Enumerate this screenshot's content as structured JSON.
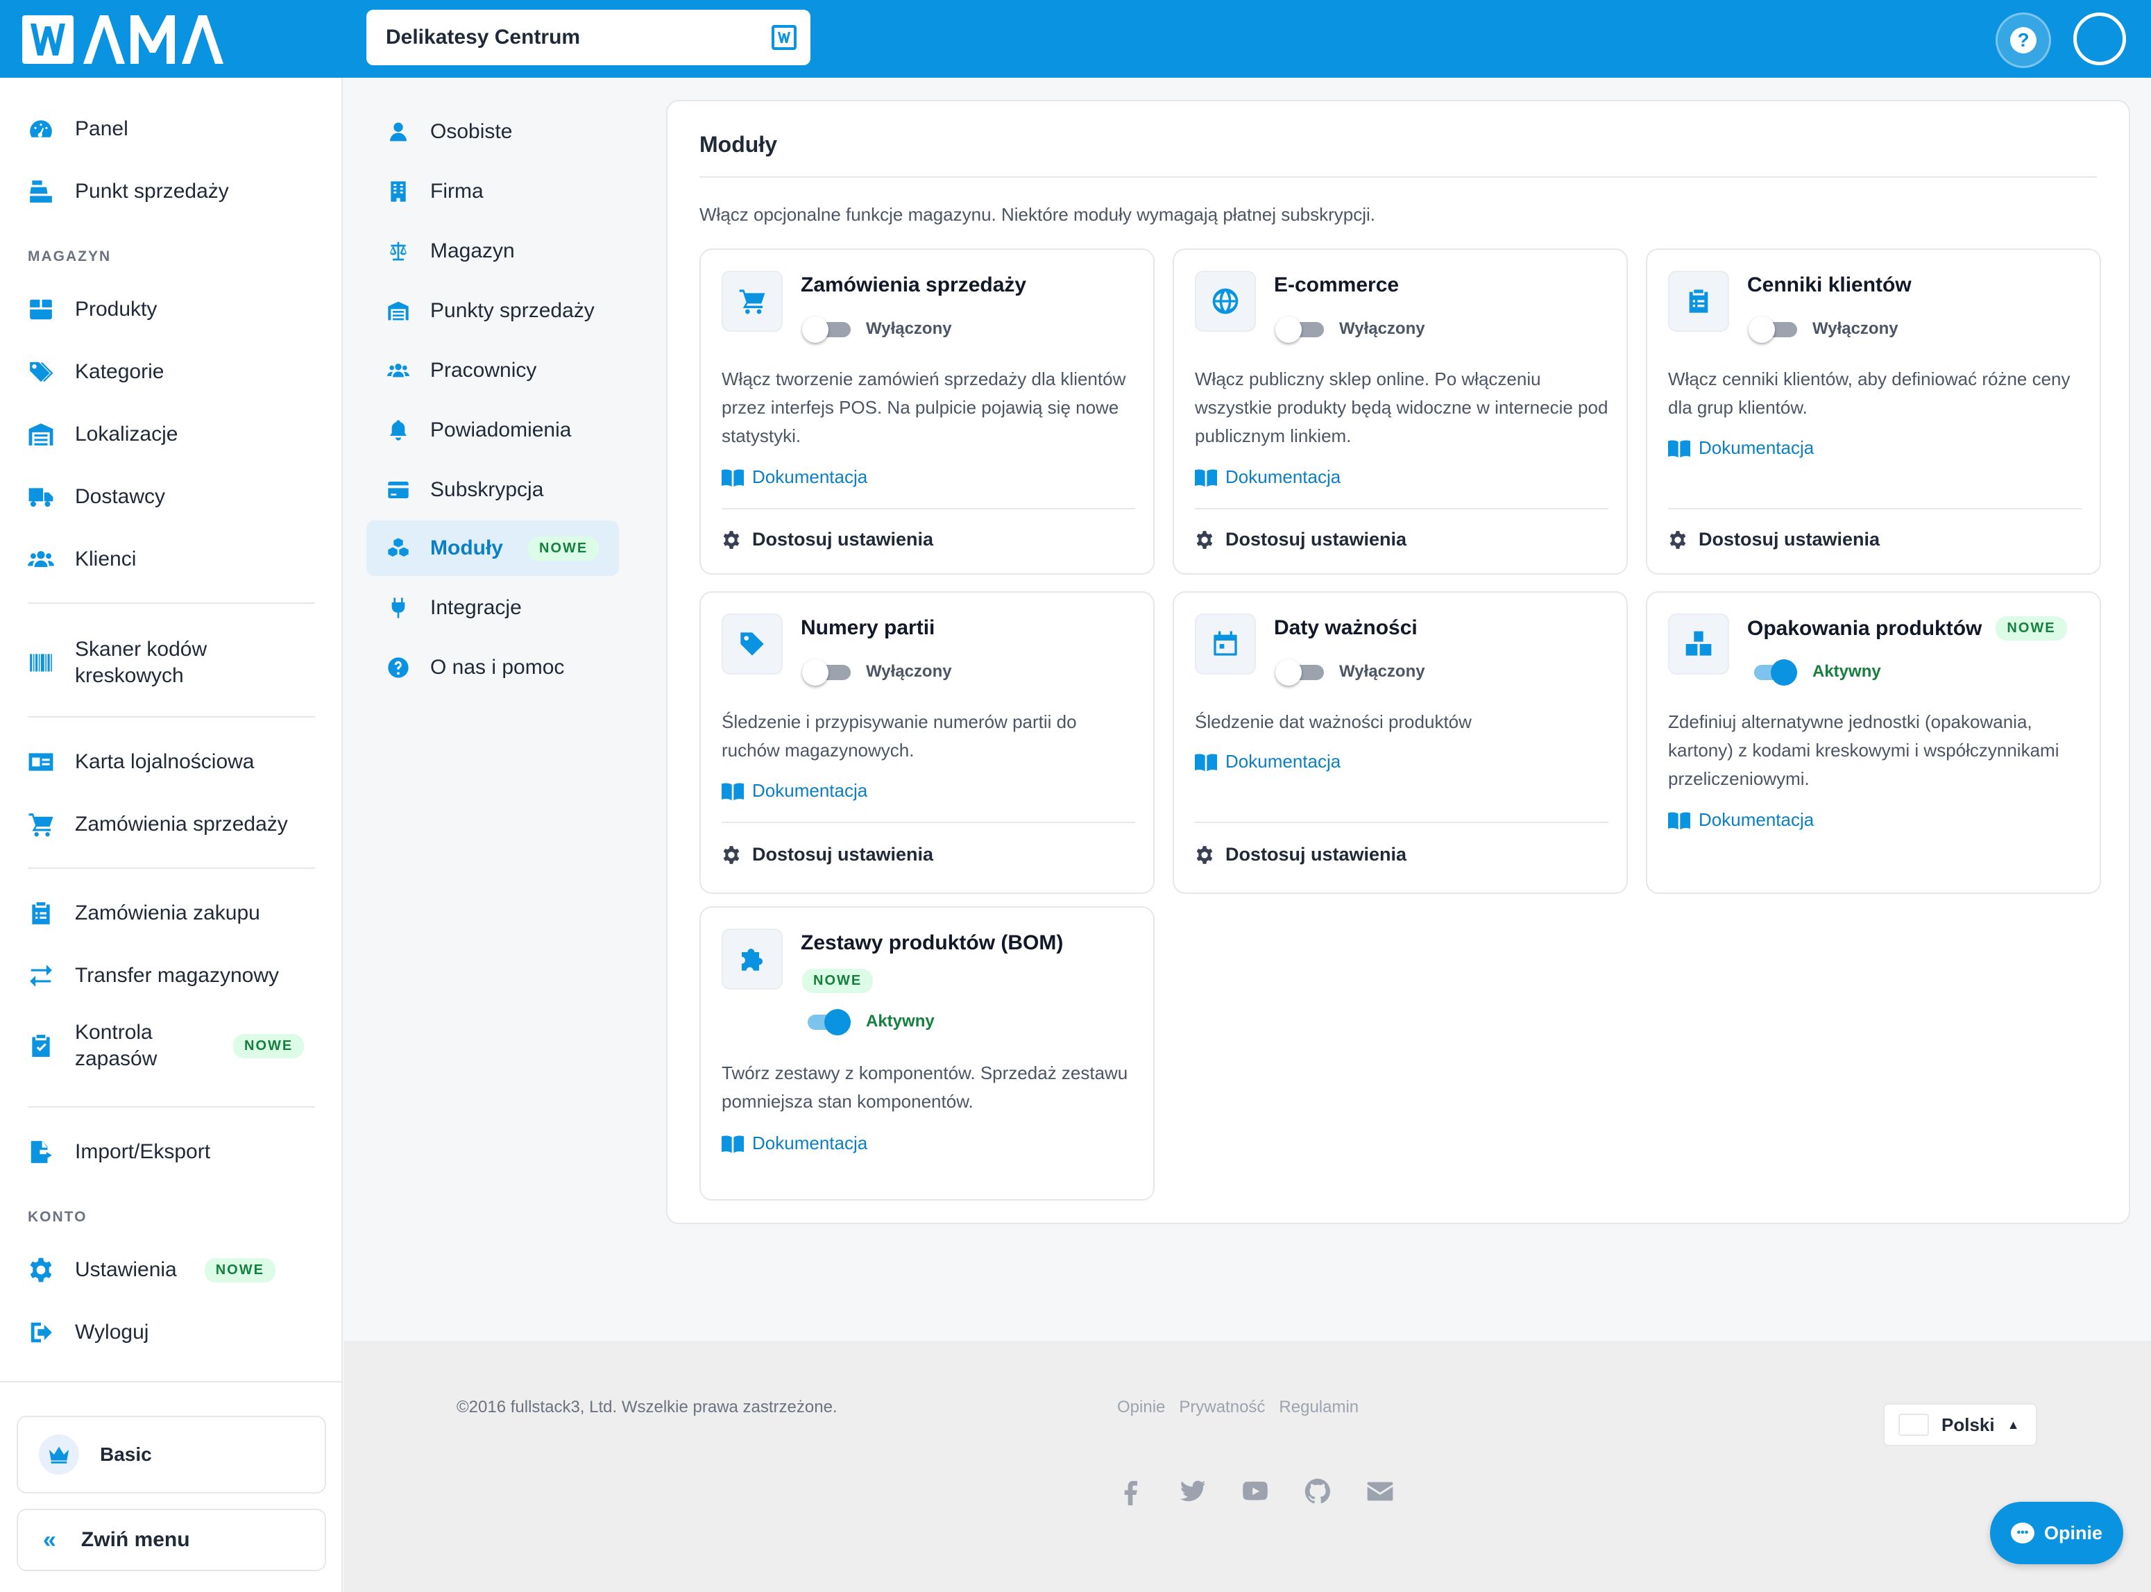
{
  "topbar": {
    "shop_name": "Delikatesy Centrum"
  },
  "sidebar": {
    "items_main": [
      {
        "label": "Panel",
        "icon": "gauge-icon"
      },
      {
        "label": "Punkt sprzedaży",
        "icon": "cash-register-icon"
      }
    ],
    "section_magazyn": "MAGAZYN",
    "items_magazyn": [
      {
        "label": "Produkty",
        "icon": "box-icon"
      },
      {
        "label": "Kategorie",
        "icon": "tags-icon"
      },
      {
        "label": "Lokalizacje",
        "icon": "warehouse-icon"
      },
      {
        "label": "Dostawcy",
        "icon": "truck-icon"
      },
      {
        "label": "Klienci",
        "icon": "users-icon"
      }
    ],
    "barcode_scanner": "Skaner kodów kreskowych",
    "loyalty_card": "Karta lojalnościowa",
    "sales_orders": "Zamówienia sprzedaży",
    "purchase_orders": "Zamówienia zakupu",
    "stock_transfer": "Transfer magazynowy",
    "stock_control": "Kontrola zapasów",
    "import_export": "Import/Eksport",
    "section_konto": "KONTO",
    "settings": "Ustawienia",
    "logout": "Wyloguj",
    "new_badge": "NOWE",
    "plan": "Basic",
    "collapse": "Zwiń menu"
  },
  "settings_nav": [
    {
      "label": "Osobiste",
      "icon": "user-icon"
    },
    {
      "label": "Firma",
      "icon": "building-icon"
    },
    {
      "label": "Magazyn",
      "icon": "scale-icon"
    },
    {
      "label": "Punkty sprzedaży",
      "icon": "store-icon"
    },
    {
      "label": "Pracownicy",
      "icon": "users-icon"
    },
    {
      "label": "Powiadomienia",
      "icon": "bell-icon"
    },
    {
      "label": "Subskrypcja",
      "icon": "credit-card-icon"
    },
    {
      "label": "Moduły",
      "icon": "cubes-icon",
      "active": true,
      "badge": "NOWE"
    },
    {
      "label": "Integracje",
      "icon": "plug-icon"
    },
    {
      "label": "O nas i pomoc",
      "icon": "question-icon"
    }
  ],
  "main": {
    "title": "Moduły",
    "description": "Włącz opcjonalne funkcje magazynu. Niektóre moduły wymagają płatnej subskrypcji.",
    "doc_label": "Dokumentacja",
    "configure_label": "Dostosuj ustawienia",
    "modules": [
      {
        "title": "Zamówienia sprzedaży",
        "icon": "cart-icon",
        "status": "Wyłączony",
        "enabled": false,
        "description": "Włącz tworzenie zamówień sprzedaży dla klientów przez interfejs POS. Na pulpicie pojawią się nowe statystyki."
      },
      {
        "title": "E-commerce",
        "icon": "globe-icon",
        "status": "Wyłączony",
        "enabled": false,
        "description": "Włącz publiczny sklep online. Po włączeniu wszystkie produkty będą widoczne w internecie pod publicznym linkiem."
      },
      {
        "title": "Cenniki klientów",
        "icon": "clipboard-list-icon",
        "status": "Wyłączony",
        "enabled": false,
        "description": "Włącz cenniki klientów, aby definiować różne ceny dla grup klientów."
      },
      {
        "title": "Numery partii",
        "icon": "tag-icon",
        "status": "Wyłączony",
        "enabled": false,
        "description": "Śledzenie i przypisywanie numerów partii do ruchów magazynowych."
      },
      {
        "title": "Daty ważności",
        "icon": "calendar-icon",
        "status": "Wyłączony",
        "enabled": false,
        "description": "Śledzenie dat ważności produktów"
      },
      {
        "title": "Opakowania produktów",
        "icon": "boxes-icon",
        "status": "Aktywny",
        "enabled": true,
        "badge": "NOWE",
        "description": "Zdefiniuj alternatywne jednostki (opakowania, kartony) z kodami kreskowymi i współczynnikami przeliczeniowymi."
      },
      {
        "title": "Zestawy produktów (BOM)",
        "icon": "puzzle-icon",
        "status": "Aktywny",
        "enabled": true,
        "badge": "NOWE",
        "description": "Twórz zestawy z komponentów. Sprzedaż zestawu pomniejsza stan komponentów."
      }
    ]
  },
  "footer": {
    "copyright": "©2016 fullstack3, Ltd. Wszelkie prawa zastrzeżone.",
    "links": [
      "Opinie",
      "Prywatność",
      "Regulamin"
    ],
    "language": "Polski",
    "social": [
      "facebook-icon",
      "twitter-icon",
      "youtube-icon",
      "github-icon",
      "envelope-icon"
    ]
  },
  "feedback_button": "Opinie",
  "colors": {
    "brand": "#0a93e0",
    "active_text": "#15803d",
    "badge_bg": "#dcfce7"
  }
}
